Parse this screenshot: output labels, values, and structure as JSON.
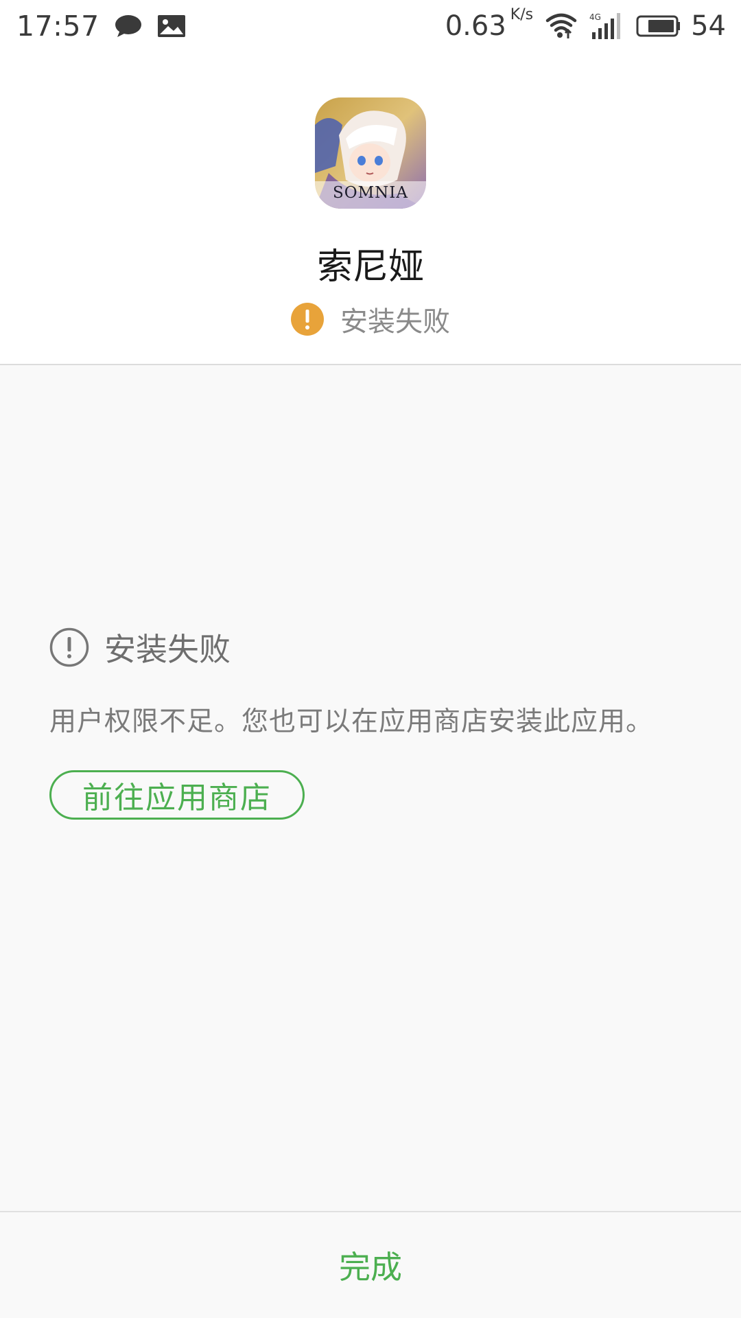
{
  "status_bar": {
    "time": "17:57",
    "notification_icons": [
      "chat-bubble-icon",
      "image-icon"
    ],
    "network_speed": "0.63",
    "network_speed_unit": "K/s",
    "network_type": "4G",
    "battery_level": "54"
  },
  "app": {
    "name": "索尼娅",
    "icon_text": "SOMNIA",
    "install_status": "安装失败",
    "status_color": "#E8A33A"
  },
  "error": {
    "title": "安装失败",
    "message": "用户权限不足。您也可以在应用商店安装此应用。",
    "store_button_label": "前往应用商店"
  },
  "footer": {
    "done_label": "完成"
  },
  "colors": {
    "accent": "#4CAF50",
    "warning": "#E8A33A"
  }
}
